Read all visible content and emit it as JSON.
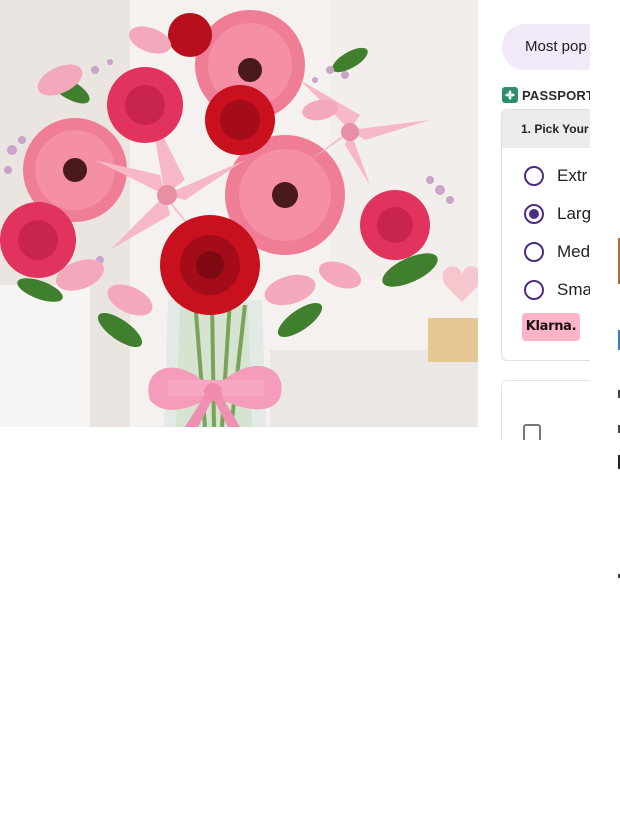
{
  "product": {
    "image_alt": "Bouquet of pink gerbera daisies, red and pink roses, pink lilies and alstroemeria in a glass vase tied with a pink ribbon",
    "colors": {
      "background": "#f3efec",
      "red_rose": "#c8101e",
      "pink_rose": "#e2335f",
      "gerbera": "#f07d96",
      "lily": "#f6b7c6",
      "leaf": "#3f7f2e",
      "ribbon": "#f59bbb"
    }
  },
  "panel": {
    "badge_label": "Most pop",
    "passport_label": "PASSPORT",
    "size_picker": {
      "header": "1. Pick Your I",
      "options": [
        {
          "label": "Extr",
          "selected": false
        },
        {
          "label": "Larg",
          "selected": true
        },
        {
          "label": "Med",
          "selected": false
        },
        {
          "label": "Sma",
          "selected": false
        }
      ]
    },
    "klarna_label": "Klarna."
  },
  "colors": {
    "accent": "#4b2e83",
    "badge_bg": "#f1e9f7",
    "klarna_pink": "#ffb3c7",
    "passport_green": "#2f8f6a"
  }
}
